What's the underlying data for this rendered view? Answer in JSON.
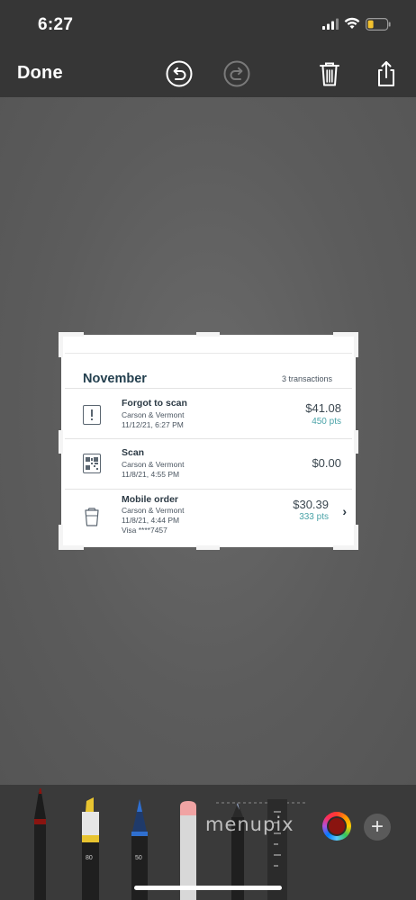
{
  "status_bar": {
    "time": "6:27",
    "icons": [
      "cellular-signal-icon",
      "wifi-icon",
      "battery-low-icon"
    ],
    "battery_color": "#f2c12e"
  },
  "toolbar": {
    "done_label": "Done",
    "icons": [
      "undo-icon",
      "redo-icon",
      "trash-icon",
      "share-icon"
    ]
  },
  "screenshot": {
    "month": "November",
    "count_label": "3 transactions",
    "transactions": [
      {
        "title": "Forgot to scan",
        "location": "Carson & Vermont",
        "datetime": "11/12/21, 6:27 PM",
        "amount": "$41.08",
        "points": "450 pts",
        "icon": "exclamation-receipt-icon"
      },
      {
        "title": "Scan",
        "location": "Carson & Vermont",
        "datetime": "11/8/21, 4:55 PM",
        "amount": "$0.00",
        "icon": "qr-code-icon"
      },
      {
        "title": "Mobile order",
        "location": "Carson & Vermont",
        "datetime": "11/8/21, 4:44 PM",
        "payment": "Visa ****7457",
        "amount": "$30.39",
        "points": "333 pts",
        "icon": "cup-icon"
      }
    ],
    "points_color": "#4aa3a8"
  },
  "palette": {
    "tools": [
      {
        "name": "pen",
        "icon": "pen-icon",
        "color": "#8a1410"
      },
      {
        "name": "marker",
        "icon": "marker-icon",
        "label": "80",
        "color": "#e8c430"
      },
      {
        "name": "pencil",
        "icon": "pencil-icon",
        "label": "50",
        "color": "#2f6fcf"
      },
      {
        "name": "eraser",
        "icon": "eraser-icon"
      },
      {
        "name": "lasso",
        "icon": "lasso-icon"
      },
      {
        "name": "ruler",
        "icon": "ruler-icon"
      }
    ],
    "watermark": "menupix",
    "current_color": "#8a1410",
    "add_label": "+"
  }
}
